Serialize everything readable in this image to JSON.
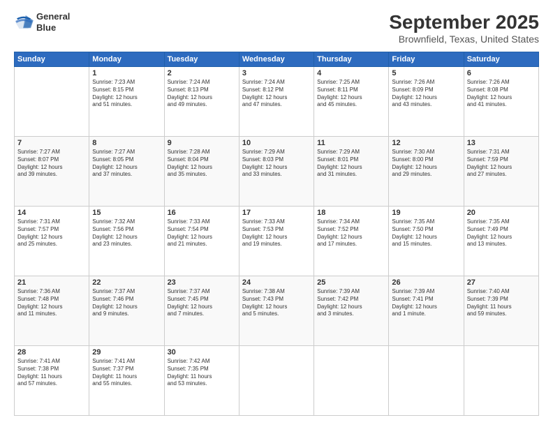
{
  "header": {
    "logo_line1": "General",
    "logo_line2": "Blue",
    "title": "September 2025",
    "subtitle": "Brownfield, Texas, United States"
  },
  "weekdays": [
    "Sunday",
    "Monday",
    "Tuesday",
    "Wednesday",
    "Thursday",
    "Friday",
    "Saturday"
  ],
  "weeks": [
    [
      {
        "day": "",
        "text": ""
      },
      {
        "day": "1",
        "text": "Sunrise: 7:23 AM\nSunset: 8:15 PM\nDaylight: 12 hours\nand 51 minutes."
      },
      {
        "day": "2",
        "text": "Sunrise: 7:24 AM\nSunset: 8:13 PM\nDaylight: 12 hours\nand 49 minutes."
      },
      {
        "day": "3",
        "text": "Sunrise: 7:24 AM\nSunset: 8:12 PM\nDaylight: 12 hours\nand 47 minutes."
      },
      {
        "day": "4",
        "text": "Sunrise: 7:25 AM\nSunset: 8:11 PM\nDaylight: 12 hours\nand 45 minutes."
      },
      {
        "day": "5",
        "text": "Sunrise: 7:26 AM\nSunset: 8:09 PM\nDaylight: 12 hours\nand 43 minutes."
      },
      {
        "day": "6",
        "text": "Sunrise: 7:26 AM\nSunset: 8:08 PM\nDaylight: 12 hours\nand 41 minutes."
      }
    ],
    [
      {
        "day": "7",
        "text": "Sunrise: 7:27 AM\nSunset: 8:07 PM\nDaylight: 12 hours\nand 39 minutes."
      },
      {
        "day": "8",
        "text": "Sunrise: 7:27 AM\nSunset: 8:05 PM\nDaylight: 12 hours\nand 37 minutes."
      },
      {
        "day": "9",
        "text": "Sunrise: 7:28 AM\nSunset: 8:04 PM\nDaylight: 12 hours\nand 35 minutes."
      },
      {
        "day": "10",
        "text": "Sunrise: 7:29 AM\nSunset: 8:03 PM\nDaylight: 12 hours\nand 33 minutes."
      },
      {
        "day": "11",
        "text": "Sunrise: 7:29 AM\nSunset: 8:01 PM\nDaylight: 12 hours\nand 31 minutes."
      },
      {
        "day": "12",
        "text": "Sunrise: 7:30 AM\nSunset: 8:00 PM\nDaylight: 12 hours\nand 29 minutes."
      },
      {
        "day": "13",
        "text": "Sunrise: 7:31 AM\nSunset: 7:59 PM\nDaylight: 12 hours\nand 27 minutes."
      }
    ],
    [
      {
        "day": "14",
        "text": "Sunrise: 7:31 AM\nSunset: 7:57 PM\nDaylight: 12 hours\nand 25 minutes."
      },
      {
        "day": "15",
        "text": "Sunrise: 7:32 AM\nSunset: 7:56 PM\nDaylight: 12 hours\nand 23 minutes."
      },
      {
        "day": "16",
        "text": "Sunrise: 7:33 AM\nSunset: 7:54 PM\nDaylight: 12 hours\nand 21 minutes."
      },
      {
        "day": "17",
        "text": "Sunrise: 7:33 AM\nSunset: 7:53 PM\nDaylight: 12 hours\nand 19 minutes."
      },
      {
        "day": "18",
        "text": "Sunrise: 7:34 AM\nSunset: 7:52 PM\nDaylight: 12 hours\nand 17 minutes."
      },
      {
        "day": "19",
        "text": "Sunrise: 7:35 AM\nSunset: 7:50 PM\nDaylight: 12 hours\nand 15 minutes."
      },
      {
        "day": "20",
        "text": "Sunrise: 7:35 AM\nSunset: 7:49 PM\nDaylight: 12 hours\nand 13 minutes."
      }
    ],
    [
      {
        "day": "21",
        "text": "Sunrise: 7:36 AM\nSunset: 7:48 PM\nDaylight: 12 hours\nand 11 minutes."
      },
      {
        "day": "22",
        "text": "Sunrise: 7:37 AM\nSunset: 7:46 PM\nDaylight: 12 hours\nand 9 minutes."
      },
      {
        "day": "23",
        "text": "Sunrise: 7:37 AM\nSunset: 7:45 PM\nDaylight: 12 hours\nand 7 minutes."
      },
      {
        "day": "24",
        "text": "Sunrise: 7:38 AM\nSunset: 7:43 PM\nDaylight: 12 hours\nand 5 minutes."
      },
      {
        "day": "25",
        "text": "Sunrise: 7:39 AM\nSunset: 7:42 PM\nDaylight: 12 hours\nand 3 minutes."
      },
      {
        "day": "26",
        "text": "Sunrise: 7:39 AM\nSunset: 7:41 PM\nDaylight: 12 hours\nand 1 minute."
      },
      {
        "day": "27",
        "text": "Sunrise: 7:40 AM\nSunset: 7:39 PM\nDaylight: 11 hours\nand 59 minutes."
      }
    ],
    [
      {
        "day": "28",
        "text": "Sunrise: 7:41 AM\nSunset: 7:38 PM\nDaylight: 11 hours\nand 57 minutes."
      },
      {
        "day": "29",
        "text": "Sunrise: 7:41 AM\nSunset: 7:37 PM\nDaylight: 11 hours\nand 55 minutes."
      },
      {
        "day": "30",
        "text": "Sunrise: 7:42 AM\nSunset: 7:35 PM\nDaylight: 11 hours\nand 53 minutes."
      },
      {
        "day": "",
        "text": ""
      },
      {
        "day": "",
        "text": ""
      },
      {
        "day": "",
        "text": ""
      },
      {
        "day": "",
        "text": ""
      }
    ]
  ]
}
